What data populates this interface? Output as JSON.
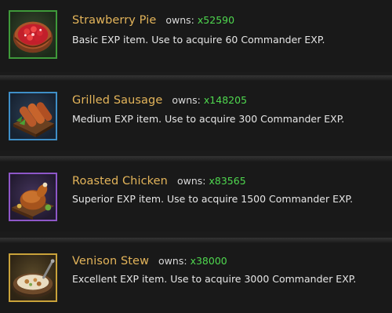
{
  "items": [
    {
      "name": "Strawberry Pie",
      "owns_label": "owns:",
      "owns_count": "x52590",
      "description": "Basic EXP item. Use to acquire 60 Commander EXP.",
      "icon": "strawberry-pie-icon",
      "rarity_color": "#3f9a3a"
    },
    {
      "name": "Grilled Sausage",
      "owns_label": "owns:",
      "owns_count": "x148205",
      "description": "Medium EXP item. Use to acquire 300 Commander EXP.",
      "icon": "grilled-sausage-icon",
      "rarity_color": "#3f8fc7"
    },
    {
      "name": "Roasted Chicken",
      "owns_label": "owns:",
      "owns_count": "x83565",
      "description": "Superior EXP item. Use to acquire 1500 Commander EXP.",
      "icon": "roasted-chicken-icon",
      "rarity_color": "#8e57c8"
    },
    {
      "name": "Venison Stew",
      "owns_label": "owns:",
      "owns_count": "x38000",
      "description": "Excellent EXP item. Use to acquire 3000 Commander EXP.",
      "icon": "venison-stew-icon",
      "rarity_color": "#c9a23a"
    }
  ],
  "colors": {
    "item_name": "#e3b45a",
    "owns_count": "#4fd84f",
    "description": "#e6e6e6",
    "background": "#1b1b1b"
  }
}
